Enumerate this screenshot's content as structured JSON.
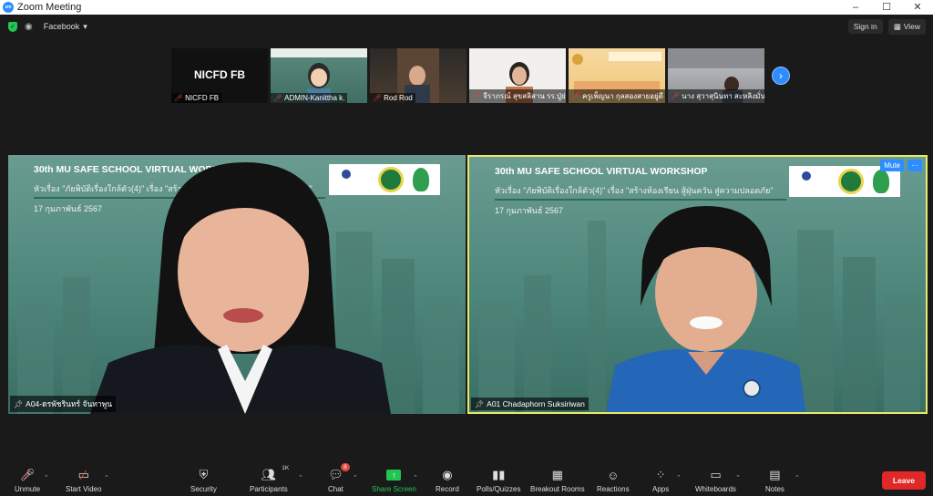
{
  "window": {
    "title": "Zoom Meeting",
    "controls": [
      "–",
      "☐",
      "✕"
    ]
  },
  "topbar": {
    "facebook_label": "Facebook",
    "sign_in": "Sign in",
    "view": "View"
  },
  "thumbnails": [
    {
      "name": "NICFD FB",
      "big": "NICFD FB"
    },
    {
      "name": "ADMIN-Kanittha k."
    },
    {
      "name": "Rod Rod"
    },
    {
      "name": "จีราภรณ์ สุขสลิสาน รร.ปู่ย่า"
    },
    {
      "name": "ครูเพ็ญนา กุลสองสายอยู่ดี"
    },
    {
      "name": "นาง สุวาสุนินทา สะหลิงมั่นยี่ ..."
    }
  ],
  "main_videos": [
    {
      "title": "30th MU SAFE SCHOOL VIRTUAL WORKSHOP",
      "subtitle": "หัวเรื่อง \"ภัยพิบัติเรื่องใกล้ตัว(4)\" เรื่อง \"สร้างห้องเรียน สู้ฝุ่นควัน สู่ความปลอดภัย\"",
      "date": "17 กุมภาพันธ์ 2567",
      "label": "A04-ดรพัชรินทร์ จันทาพูน"
    },
    {
      "title": "30th MU SAFE SCHOOL VIRTUAL WORKSHOP",
      "subtitle": "หัวเรื่อง \"ภัยพิบัติเรื่องใกล้ตัว(4)\" เรื่อง \"สร้างห้องเรียน สู้ฝุ่นควัน สู่ความปลอดภัย\"",
      "date": "17 กุมภาพันธ์ 2567",
      "label": "A01 Chadaphorn Suksiriwan",
      "mute": "Mute",
      "more": "···"
    }
  ],
  "toolbar": {
    "unmute": "Unmute",
    "start_video": "Start Video",
    "security": "Security",
    "participants": "Participants",
    "participants_count": "1K",
    "chat": "Chat",
    "chat_badge": "8",
    "share_screen": "Share Screen",
    "record": "Record",
    "polls": "Polls/Quizzes",
    "breakout": "Breakout Rooms",
    "reactions": "Reactions",
    "apps": "Apps",
    "whiteboards": "Whiteboards",
    "notes": "Notes",
    "leave": "Leave"
  },
  "colors": {
    "accent": "#2d8cff",
    "active_speaker": "#e7ea6a",
    "leave": "#e02828",
    "share": "#23c552"
  }
}
